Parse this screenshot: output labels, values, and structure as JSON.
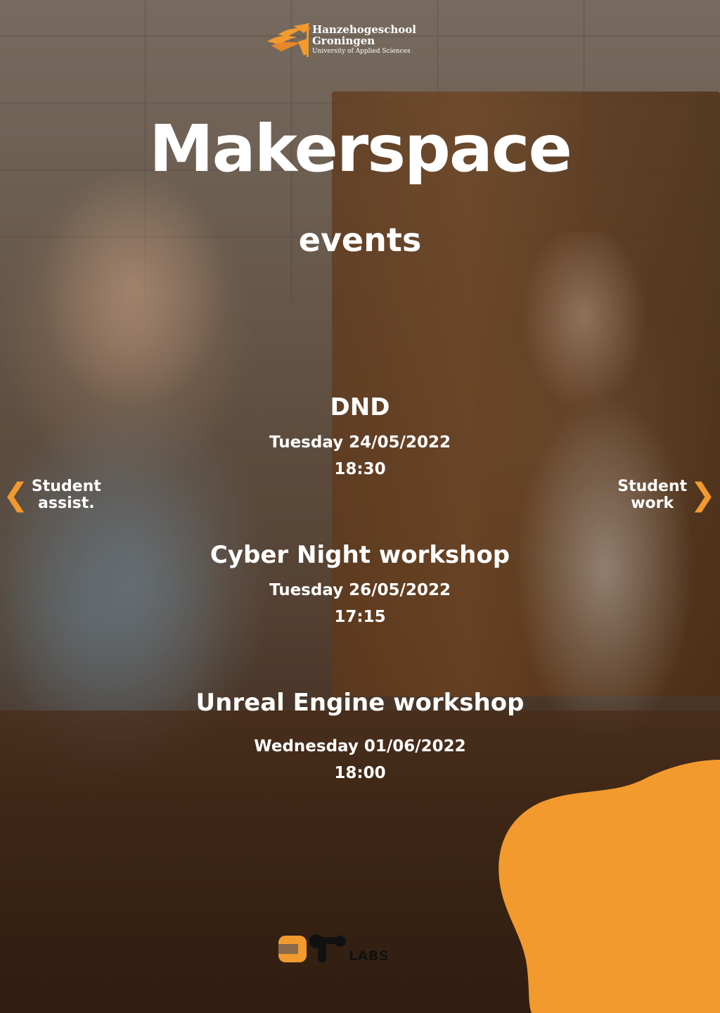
{
  "header": {
    "institution_line1": "Hanzehogeschool",
    "institution_line2": "Groningen",
    "institution_line3": "University of Applied Sciences"
  },
  "title": "Makerspace",
  "subtitle": "events",
  "events": [
    {
      "name": "DND",
      "date": "Tuesday 24/05/2022",
      "time": "18:30"
    },
    {
      "name": "Cyber Night workshop",
      "date": "Tuesday 26/05/2022",
      "time": "17:15"
    },
    {
      "name": "Unreal Engine workshop",
      "date": "Wednesday 01/06/2022",
      "time": "18:00"
    }
  ],
  "nav": {
    "prev_line1": "Student",
    "prev_line2": "assist.",
    "next_line1": "Student",
    "next_line2": "work",
    "prev_icon": "chevron-left-icon",
    "next_icon": "chevron-right-icon"
  },
  "footer": {
    "labs_text": "LABS"
  },
  "colors": {
    "accent": "#f29a2e",
    "text": "#ffffff",
    "labs_dark": "#111111"
  }
}
